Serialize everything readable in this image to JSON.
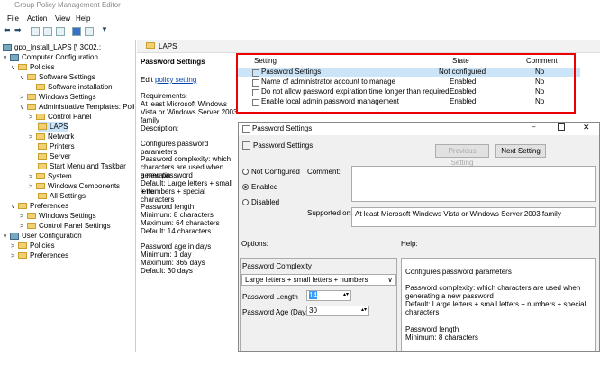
{
  "window": {
    "title": "Group Policy Management Editor"
  },
  "menu": [
    "File",
    "Action",
    "View",
    "Help"
  ],
  "tree": {
    "root": "gpo_Install_LAPS [\\ 3C02.:",
    "items": [
      "Computer Configuration",
      "Policies",
      "Software Settings",
      "Software installation",
      "Windows Settings",
      "Administrative Templates: Polic",
      "Control Panel",
      "LAPS",
      "Network",
      "Printers",
      "Server",
      "Start Menu and Taskbar",
      "System",
      "Windows Components",
      "All Settings",
      "Preferences",
      "Windows Settings",
      "Control Panel Settings",
      "User Configuration",
      "Policies",
      "Preferences"
    ]
  },
  "header": {
    "folder": "LAPS"
  },
  "description": {
    "title": "Password Settings",
    "edit_prefix": "Edit ",
    "edit_link": "policy setting",
    "req_label": "Requirements:",
    "req_text": "At least Microsoft Windows Vista or Windows Server 2003 family",
    "desc_label": "Description:",
    "lines": [
      "Configures password parameters",
      "Password complexity: which",
      "characters are used when generatin",
      "a new password",
      "Default: Large letters + small lette",
      "+ numbers + special characters",
      "Password length",
      "Minimum: 8 characters",
      "Maximum: 64 characters",
      "Default: 14 characters",
      "Password age in days",
      "Minimum: 1 day",
      "Maximum: 365 days",
      "Default: 30 days"
    ]
  },
  "settings": {
    "columns": [
      "Setting",
      "State",
      "Comment"
    ],
    "rows": [
      {
        "name": "Password Settings",
        "state": "Not configured",
        "comment": "No"
      },
      {
        "name": "Name of administrator account to manage",
        "state": "Enabled",
        "comment": "No"
      },
      {
        "name": "Do not allow password expiration time longer than required ...",
        "state": "Enabled",
        "comment": "No"
      },
      {
        "name": "Enable local admin password management",
        "state": "Enabled",
        "comment": "No"
      }
    ]
  },
  "dialog": {
    "title": "Password Settings",
    "subtitle": "Password Settings",
    "prev_btn": "Previous Setting",
    "next_btn": "Next Setting",
    "radio": [
      "Not Configured",
      "Enabled",
      "Disabled"
    ],
    "comment_label": "Comment:",
    "supported_label": "Supported on:",
    "supported_value": "At least Microsoft Windows Vista or Windows Server 2003 family",
    "options_label": "Options:",
    "help_label": "Help:",
    "complexity_label": "Password Complexity",
    "complexity_value": "Large letters + small letters + numbers",
    "length_label": "Password Length",
    "length_value": "14",
    "age_label": "Password Age (Days)",
    "age_value": "30",
    "help_lines": [
      "Configures password parameters",
      "Password complexity: which characters are used when",
      "generating a new password",
      "Default: Large letters + small letters + numbers + special",
      "characters",
      "Password length",
      "Minimum: 8 characters"
    ]
  }
}
